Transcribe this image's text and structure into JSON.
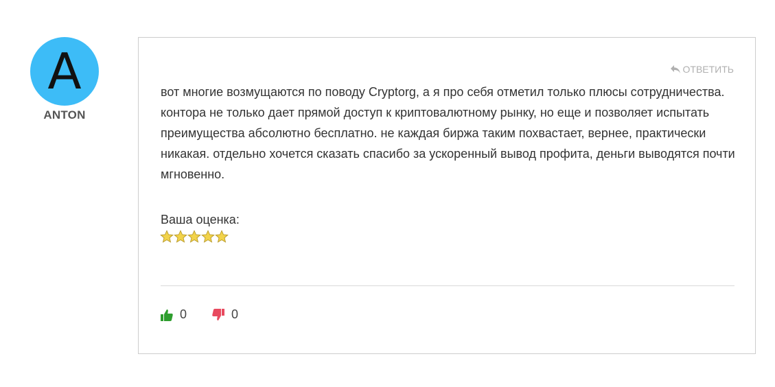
{
  "author": {
    "initial": "A",
    "name": "ANTON",
    "avatar_color": "#3dbcf7"
  },
  "comment": {
    "reply_label": "ОТВЕТИТЬ",
    "reply_icon": "reply-arrow-icon",
    "text": "вот многие возмущаются по поводу Cryptorg, а я про себя отметил только плюсы сотрудничества. контора не только дает прямой доступ к криптовалютному рынку, но еще и позволяет испытать преимущества абсолютно бесплатно. не каждая биржа таким похвастает, вернее, практически никакая. отдельно хочется сказать спасибо за ускоренный вывод профита, деньги выводятся почти мгновенно.",
    "rating_label": "Ваша оценка:",
    "rating": {
      "value": 5,
      "max": 5
    },
    "star_color": "#f2d34a"
  },
  "votes": {
    "up": {
      "count": "0",
      "icon": "thumbs-up-icon",
      "color": "#2e9e2e"
    },
    "down": {
      "count": "0",
      "icon": "thumbs-down-icon",
      "color": "#e84a5f"
    }
  }
}
